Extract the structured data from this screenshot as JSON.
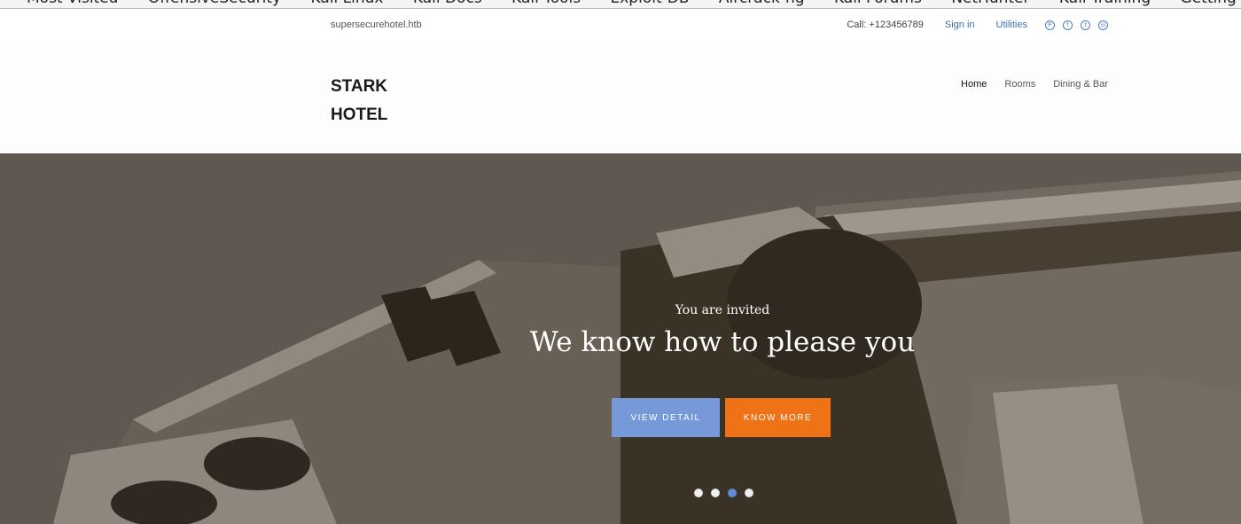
{
  "browser": {
    "bookmarks": [
      "Most Visited",
      "OffensiveSecurity",
      "Kali Linux",
      "Kali Docs",
      "Kali Tools",
      "Exploit-DB",
      "Aircrack-ng",
      "Kali Forums",
      "NetHunter",
      "Kali Training",
      "Getting Started"
    ]
  },
  "topbar": {
    "site_url": "supersecurehotel.htb",
    "call": "Call: +123456789",
    "sign_in": "Sign in",
    "utilities": "Utilities",
    "social_icons": [
      "pinterest-icon",
      "facebook-icon",
      "twitter-icon",
      "dribbble-icon"
    ]
  },
  "header": {
    "logo_line1": "STARK",
    "logo_line2": "HOTEL",
    "nav": [
      {
        "label": "Home",
        "active": true
      },
      {
        "label": "Rooms",
        "active": false
      },
      {
        "label": "Dining & Bar",
        "active": false
      }
    ]
  },
  "hero": {
    "subtitle": "You are invited",
    "title": "We know how to please you",
    "primary_button": "View Detail",
    "secondary_button": "Know More",
    "slides_count": 4,
    "active_slide": 3,
    "colors": {
      "primary": "#7599d9",
      "secondary": "#ef7316"
    }
  }
}
